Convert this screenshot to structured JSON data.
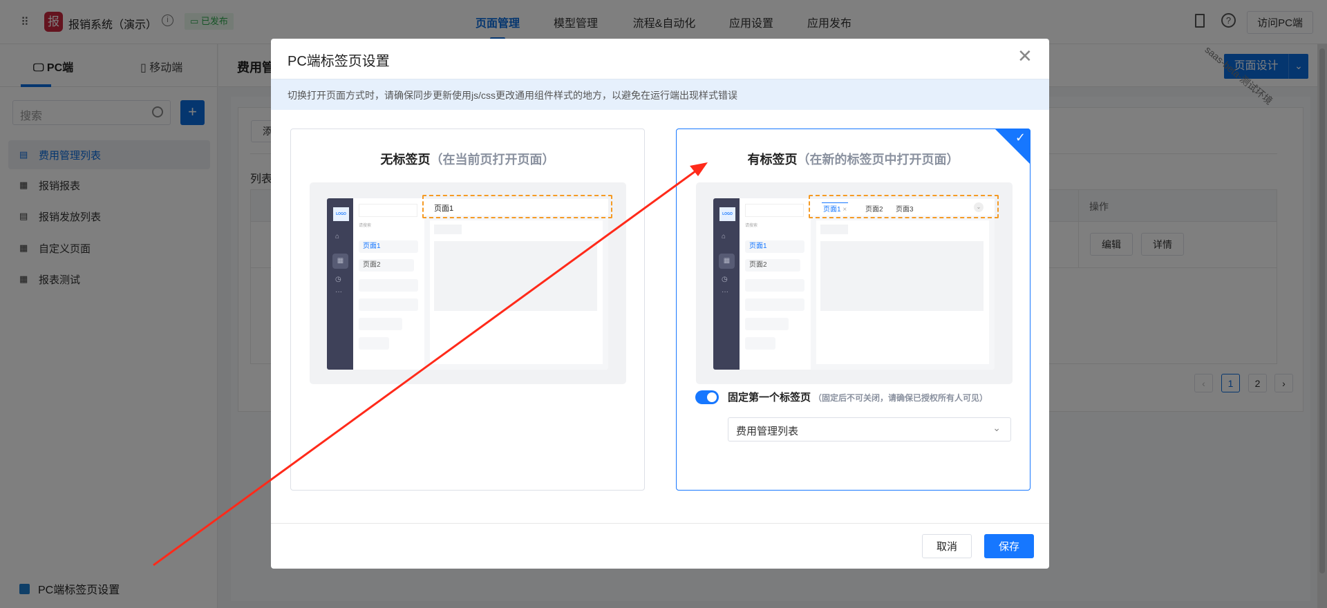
{
  "header": {
    "app_icon_text": "报",
    "app_name": "报销系统（演示）",
    "status": "已发布",
    "nav": [
      "页面管理",
      "模型管理",
      "流程&自动化",
      "应用设置",
      "应用发布"
    ],
    "visit_button": "访问PC端",
    "watermark": "saas-beta-测试环境"
  },
  "sidebar": {
    "tabs": [
      "PC端",
      "移动端"
    ],
    "search_placeholder": "搜索",
    "add_label": "+",
    "items": [
      {
        "label": "费用管理列表",
        "icon": "list-icon"
      },
      {
        "label": "报销报表",
        "icon": "grid-icon"
      },
      {
        "label": "报销发放列表",
        "icon": "list-icon"
      },
      {
        "label": "自定义页面",
        "icon": "grid-icon"
      },
      {
        "label": "报表测试",
        "icon": "grid-icon"
      }
    ],
    "bottom_link": "PC端标签页设置"
  },
  "main": {
    "title": "费用管",
    "design_button": "页面设计",
    "add_button": "添",
    "section": "列表",
    "table": {
      "action_header": "操作",
      "actions": [
        "编辑",
        "详情"
      ]
    },
    "pagination": {
      "pages": [
        "1",
        "2"
      ],
      "current": "1"
    }
  },
  "modal": {
    "title": "PC端标签页设置",
    "notice": "切换打开页面方式时，请确保同步更新使用js/css更改通用组件样式的地方，以避免在运行端出现样式错误",
    "options": [
      {
        "title": "无标签页",
        "subtitle": "（在当前页打开页面）",
        "selected": false
      },
      {
        "title": "有标签页",
        "subtitle": "（在新的标签页中打开页面）",
        "selected": true
      }
    ],
    "mock": {
      "logo": "LOGO",
      "search": "请搜索",
      "page1": "页面1",
      "page2": "页面2",
      "page3": "页面3",
      "close": "×"
    },
    "pin_first_tab": {
      "label": "固定第一个标签页",
      "hint": "（固定后不可关闭，请确保已授权所有人可见）",
      "enabled": true
    },
    "pinned_page": "费用管理列表",
    "cancel": "取消",
    "save": "保存"
  },
  "colors": {
    "primary": "#1677ff",
    "accent_dashed": "#f59a23",
    "annotation_arrow": "#ff2a1a"
  }
}
